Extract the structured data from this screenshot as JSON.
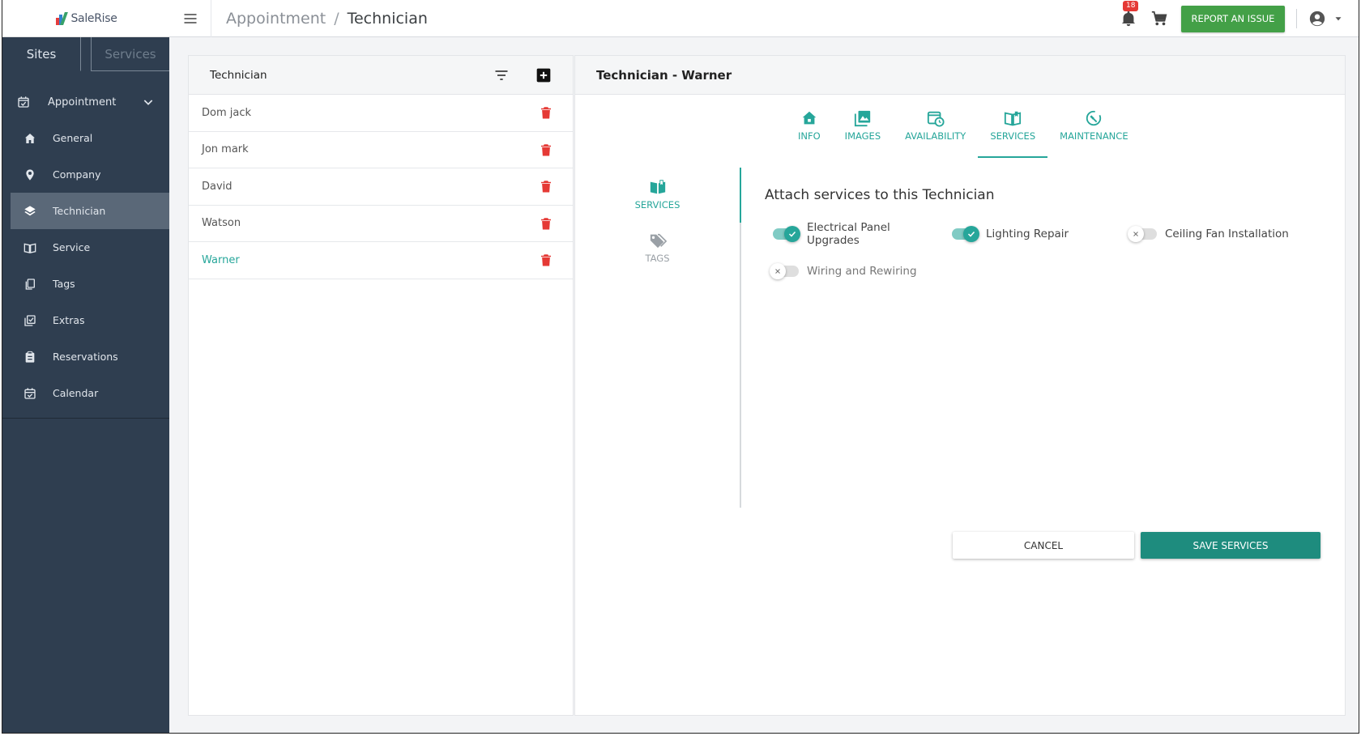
{
  "brand": {
    "name": "SaleRise"
  },
  "sidebar": {
    "tabs": [
      {
        "label": "Sites",
        "active": true
      },
      {
        "label": "Services",
        "active": false
      }
    ],
    "group": {
      "label": "Appointment",
      "icon": "calendar-check-icon"
    },
    "items": [
      {
        "label": "General",
        "icon": "home-icon",
        "active": false
      },
      {
        "label": "Company",
        "icon": "location-pin-icon",
        "active": false
      },
      {
        "label": "Technician",
        "icon": "layers-icon",
        "active": true
      },
      {
        "label": "Service",
        "icon": "book-open-icon",
        "active": false
      },
      {
        "label": "Tags",
        "icon": "copy-icon",
        "active": false
      },
      {
        "label": "Extras",
        "icon": "checklist-icon",
        "active": false
      },
      {
        "label": "Reservations",
        "icon": "clipboard-icon",
        "active": false
      },
      {
        "label": "Calendar",
        "icon": "calendar-icon",
        "active": false
      }
    ]
  },
  "topbar": {
    "breadcrumb": [
      "Appointment",
      "Technician"
    ],
    "separator": "/",
    "notifications_count": "18",
    "report_label": "REPORT AN ISSUE"
  },
  "list": {
    "title": "Technician",
    "rows": [
      {
        "name": "Dom jack",
        "selected": false
      },
      {
        "name": "Jon mark",
        "selected": false
      },
      {
        "name": "David",
        "selected": false
      },
      {
        "name": "Watson",
        "selected": false
      },
      {
        "name": "Warner",
        "selected": true
      }
    ]
  },
  "detail": {
    "title": "Technician - Warner",
    "tabs": [
      {
        "label": "INFO",
        "icon": "home-icon",
        "active": false
      },
      {
        "label": "IMAGES",
        "icon": "images-icon",
        "active": false
      },
      {
        "label": "AVAILABILITY",
        "icon": "calendar-clock-icon",
        "active": false
      },
      {
        "label": "SERVICES",
        "icon": "book-open-icon",
        "active": true
      },
      {
        "label": "MAINTENANCE",
        "icon": "wrench-clock-icon",
        "active": false
      }
    ],
    "subnav": [
      {
        "label": "SERVICES",
        "icon": "book-open-icon",
        "active": true
      },
      {
        "label": "TAGS",
        "icon": "tags-icon",
        "active": false
      }
    ],
    "services_title": "Attach services to this Technician",
    "services": [
      {
        "label": "Electrical Panel Upgrades",
        "enabled": true
      },
      {
        "label": "Lighting Repair",
        "enabled": true
      },
      {
        "label": "Ceiling Fan Installation",
        "enabled": false
      },
      {
        "label": "Wiring and Rewiring",
        "enabled": false
      }
    ],
    "cancel_label": "CANCEL",
    "save_label": "SAVE SERVICES"
  },
  "colors": {
    "accent": "#26a69a",
    "sidebar_bg": "#2f3e50",
    "report_green": "#43a047",
    "delete_red": "#e53935",
    "save_teal": "#1e8c7e"
  }
}
